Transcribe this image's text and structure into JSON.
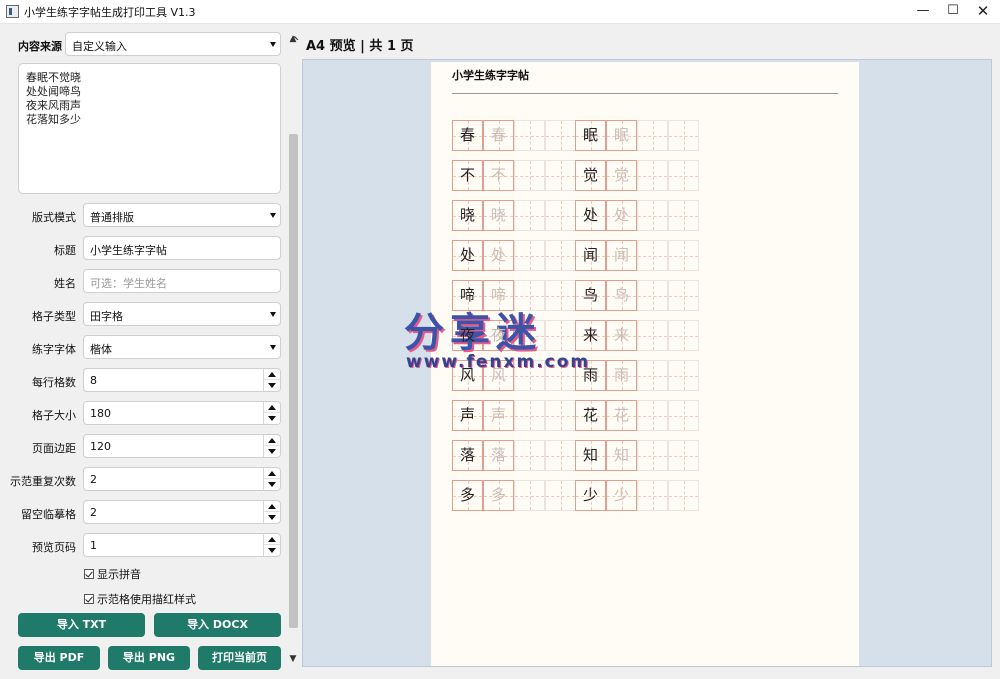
{
  "window": {
    "title": "小学生练字字帖生成打印工具 V1.3",
    "minimize_glyph": "—",
    "maximize_glyph": "☐",
    "close_glyph": "✕"
  },
  "sidebar": {
    "content_source": {
      "label": "内容来源",
      "value": "自定义输入"
    },
    "text_lines": [
      "春眠不觉晓",
      "处处闻啼鸟",
      "夜来风雨声",
      "花落知多少"
    ],
    "layout_mode": {
      "label": "版式模式",
      "value": "普通排版"
    },
    "title_field": {
      "label": "标题",
      "value": "小学生练字字帖"
    },
    "name_field": {
      "label": "姓名",
      "placeholder": "可选：学生姓名"
    },
    "grid_type": {
      "label": "格子类型",
      "value": "田字格"
    },
    "font": {
      "label": "练字字体",
      "value": "楷体"
    },
    "per_row": {
      "label": "每行格数",
      "value": "8"
    },
    "grid_size": {
      "label": "格子大小",
      "value": "180"
    },
    "margin": {
      "label": "页面边距",
      "value": "120"
    },
    "demo_repeat": {
      "label": "示范重复次数",
      "value": "2"
    },
    "blank_trace": {
      "label": "留空临摹格",
      "value": "2"
    },
    "preview_page": {
      "label": "预览页码",
      "value": "1"
    },
    "show_pinyin": {
      "label": "显示拼音",
      "checked": true
    },
    "red_trace": {
      "label": "示范格使用描红样式",
      "checked": true
    },
    "buttons": {
      "import_txt": "导入 TXT",
      "import_docx": "导入 DOCX",
      "export_pdf": "导出 PDF",
      "export_png": "导出 PNG",
      "print_page": "打印当前页"
    }
  },
  "preview": {
    "header": "A4 预览  |  共 1 页",
    "page_title": "小学生练字字帖",
    "left_column": [
      "春",
      "不",
      "晓",
      "处",
      "啼",
      "夜",
      "风",
      "声",
      "落",
      "多"
    ],
    "right_column": [
      "眠",
      "觉",
      "处",
      "闻",
      "鸟",
      "来",
      "雨",
      "花",
      "知",
      "少"
    ]
  },
  "watermark": {
    "main": "分享迷",
    "sub": "www.fenxm.com"
  },
  "colors": {
    "accent": "#1f7a69",
    "grid_red": "#e0a08f"
  }
}
